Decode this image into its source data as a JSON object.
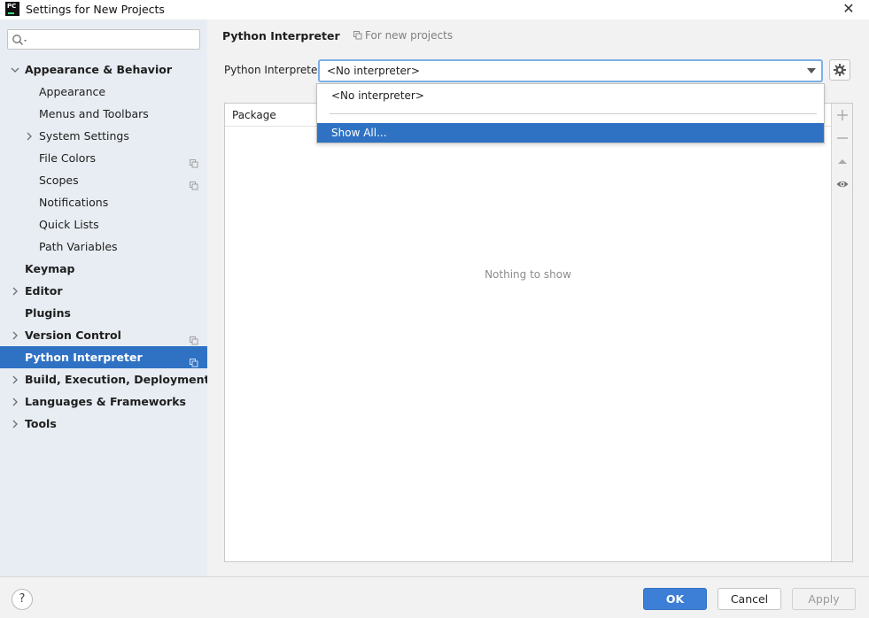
{
  "window": {
    "title": "Settings for New Projects",
    "close_glyph": "✕"
  },
  "app_logo": {
    "text": "PC",
    "icon": "pycharm-logo-icon"
  },
  "search": {
    "value": "",
    "placeholder": ""
  },
  "sidebar": {
    "items": [
      {
        "label": "Appearance & Behavior",
        "level": 0,
        "bold": true,
        "expandable": true,
        "expanded": true,
        "project_icon": false,
        "selected": false
      },
      {
        "label": "Appearance",
        "level": 1,
        "bold": false,
        "expandable": false,
        "expanded": false,
        "project_icon": false,
        "selected": false
      },
      {
        "label": "Menus and Toolbars",
        "level": 1,
        "bold": false,
        "expandable": false,
        "expanded": false,
        "project_icon": false,
        "selected": false
      },
      {
        "label": "System Settings",
        "level": 1,
        "bold": false,
        "expandable": true,
        "expanded": false,
        "project_icon": false,
        "selected": false
      },
      {
        "label": "File Colors",
        "level": 1,
        "bold": false,
        "expandable": false,
        "expanded": false,
        "project_icon": true,
        "selected": false
      },
      {
        "label": "Scopes",
        "level": 1,
        "bold": false,
        "expandable": false,
        "expanded": false,
        "project_icon": true,
        "selected": false
      },
      {
        "label": "Notifications",
        "level": 1,
        "bold": false,
        "expandable": false,
        "expanded": false,
        "project_icon": false,
        "selected": false
      },
      {
        "label": "Quick Lists",
        "level": 1,
        "bold": false,
        "expandable": false,
        "expanded": false,
        "project_icon": false,
        "selected": false
      },
      {
        "label": "Path Variables",
        "level": 1,
        "bold": false,
        "expandable": false,
        "expanded": false,
        "project_icon": false,
        "selected": false
      },
      {
        "label": "Keymap",
        "level": 0,
        "bold": true,
        "expandable": false,
        "expanded": false,
        "project_icon": false,
        "selected": false
      },
      {
        "label": "Editor",
        "level": 0,
        "bold": true,
        "expandable": true,
        "expanded": false,
        "project_icon": false,
        "selected": false
      },
      {
        "label": "Plugins",
        "level": 0,
        "bold": true,
        "expandable": false,
        "expanded": false,
        "project_icon": false,
        "selected": false
      },
      {
        "label": "Version Control",
        "level": 0,
        "bold": true,
        "expandable": true,
        "expanded": false,
        "project_icon": true,
        "selected": false
      },
      {
        "label": "Python Interpreter",
        "level": 0,
        "bold": true,
        "expandable": false,
        "expanded": false,
        "project_icon": true,
        "selected": true
      },
      {
        "label": "Build, Execution, Deployment",
        "level": 0,
        "bold": true,
        "expandable": true,
        "expanded": false,
        "project_icon": false,
        "selected": false
      },
      {
        "label": "Languages & Frameworks",
        "level": 0,
        "bold": true,
        "expandable": true,
        "expanded": false,
        "project_icon": false,
        "selected": false
      },
      {
        "label": "Tools",
        "level": 0,
        "bold": true,
        "expandable": true,
        "expanded": false,
        "project_icon": false,
        "selected": false
      }
    ]
  },
  "content": {
    "title": "Python Interpreter",
    "scope_note": "For new projects",
    "interpreter_label": "Python Interpreter:",
    "interpreter_value": "<No interpreter>",
    "table": {
      "columns": [
        "Package"
      ],
      "empty_text": "Nothing to show"
    },
    "dropdown": {
      "options": [
        "<No interpreter>",
        "Show All..."
      ],
      "selected_index": 1
    }
  },
  "footer": {
    "help_label": "?",
    "ok_label": "OK",
    "cancel_label": "Cancel",
    "apply_label": "Apply"
  },
  "colors": {
    "selection": "#2f72c4",
    "sidebar_bg": "#e8edf3",
    "ok_button": "#3d7fd6",
    "focus_border": "#7daee6"
  }
}
